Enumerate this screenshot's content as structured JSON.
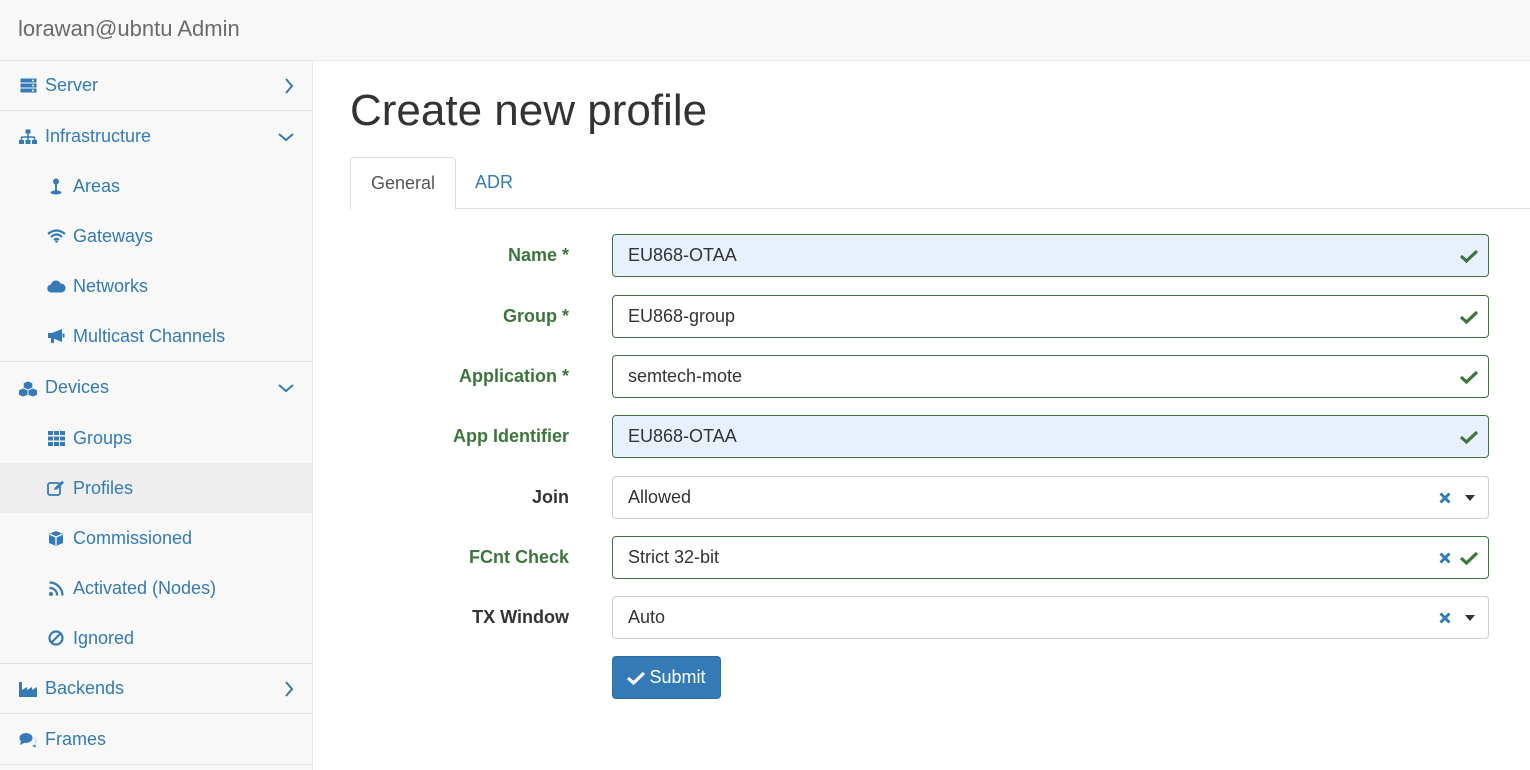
{
  "app": {
    "title": "lorawan@ubntu Admin"
  },
  "sidebar": {
    "items": [
      {
        "label": "Server",
        "icon": "server-icon"
      },
      {
        "label": "Infrastructure",
        "icon": "sitemap-icon"
      },
      {
        "label": "Areas",
        "icon": "map-pin-icon"
      },
      {
        "label": "Gateways",
        "icon": "wifi-icon"
      },
      {
        "label": "Networks",
        "icon": "cloud-icon"
      },
      {
        "label": "Multicast Channels",
        "icon": "bullhorn-icon"
      },
      {
        "label": "Devices",
        "icon": "cubes-icon"
      },
      {
        "label": "Groups",
        "icon": "grid-icon"
      },
      {
        "label": "Profiles",
        "icon": "edit-icon"
      },
      {
        "label": "Commissioned",
        "icon": "cube-icon"
      },
      {
        "label": "Activated (Nodes)",
        "icon": "rss-icon"
      },
      {
        "label": "Ignored",
        "icon": "ban-icon"
      },
      {
        "label": "Backends",
        "icon": "industry-icon"
      },
      {
        "label": "Frames",
        "icon": "comments-icon"
      }
    ]
  },
  "page": {
    "title": "Create new profile"
  },
  "tabs": [
    {
      "label": "General"
    },
    {
      "label": "ADR"
    }
  ],
  "form": {
    "name": {
      "label": "Name *",
      "value": "EU868-OTAA"
    },
    "group": {
      "label": "Group *",
      "value": "EU868-group"
    },
    "application": {
      "label": "Application *",
      "value": "semtech-mote"
    },
    "app_identifier": {
      "label": "App Identifier",
      "value": "EU868-OTAA"
    },
    "join": {
      "label": "Join",
      "value": "Allowed"
    },
    "fcnt_check": {
      "label": "FCnt Check",
      "value": "Strict 32-bit"
    },
    "tx_window": {
      "label": "TX Window",
      "value": "Auto"
    },
    "submit_label": "Submit"
  },
  "colors": {
    "link": "#337ab7",
    "success": "#3c763d",
    "primary": "#337ab7",
    "autofill": "#e8f0fe"
  }
}
